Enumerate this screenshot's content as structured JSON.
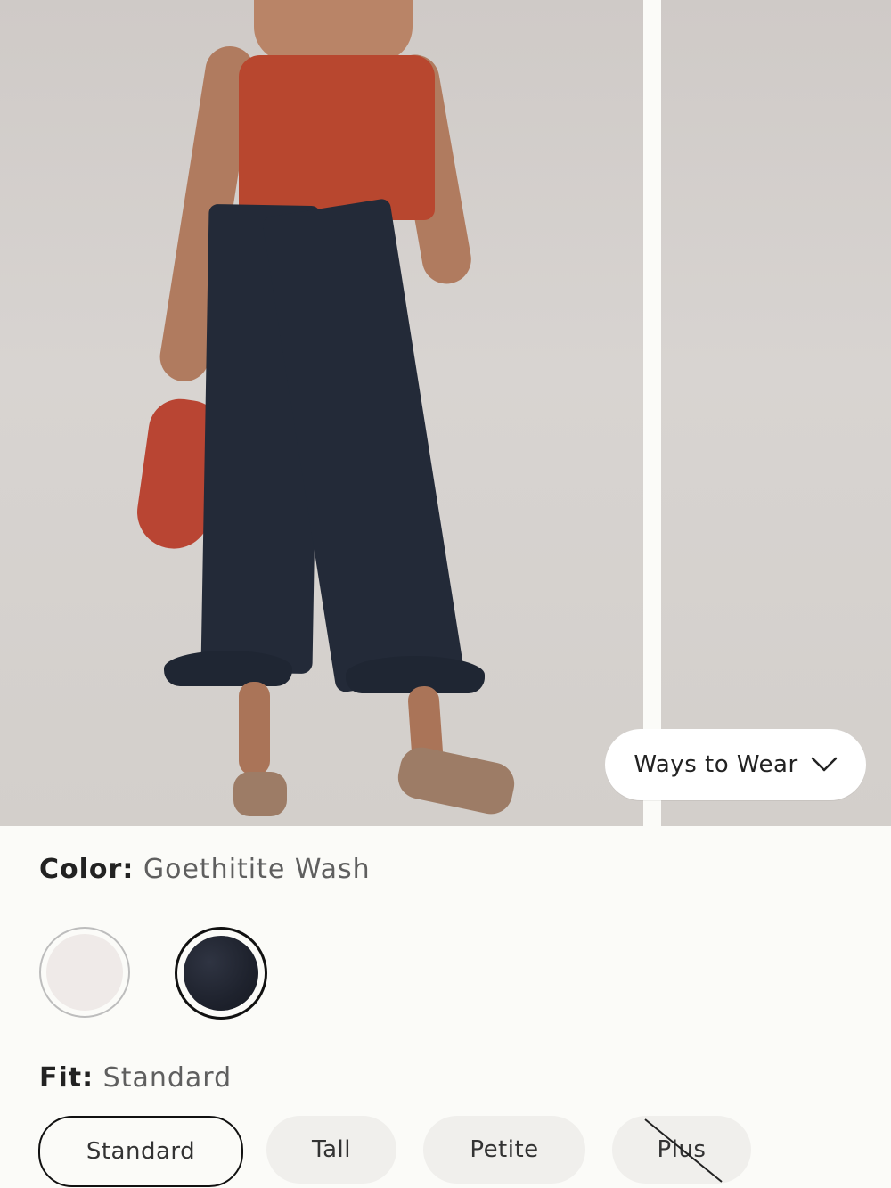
{
  "gallery": {
    "images": [
      {
        "semantic": "model-front-photo"
      },
      {
        "semantic": "jeans-detail-photo"
      }
    ],
    "ways_to_wear": {
      "label": "Ways to Wear",
      "icon": "chevron-down-icon"
    }
  },
  "product": {
    "color": {
      "label": "Color:",
      "value": "Goethitite Wash",
      "swatches": [
        {
          "name": "light",
          "selected": false
        },
        {
          "name": "dark denim",
          "selected": true
        }
      ]
    },
    "fit": {
      "label": "Fit:",
      "value": "Standard",
      "options": [
        {
          "label": "Standard",
          "selected": true,
          "available": true
        },
        {
          "label": "Tall",
          "selected": false,
          "available": true
        },
        {
          "label": "Petite",
          "selected": false,
          "available": true
        },
        {
          "label": "Plus",
          "selected": false,
          "available": false
        }
      ]
    }
  }
}
